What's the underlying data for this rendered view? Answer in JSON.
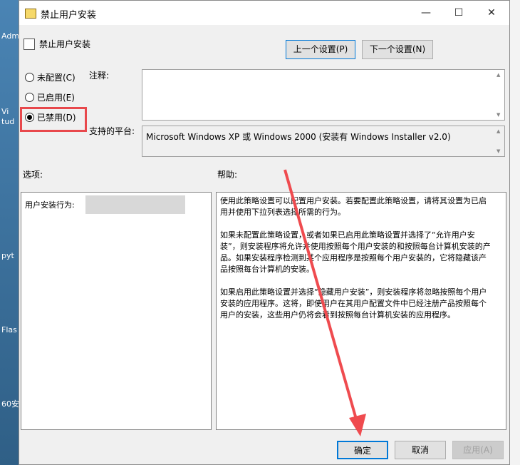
{
  "window": {
    "title": "禁止用户安装",
    "policy_name": "禁止用户安装"
  },
  "titlebar": {
    "minimize_glyph": "—",
    "maximize_glyph": "☐",
    "close_glyph": "✕"
  },
  "nav": {
    "prev_label": "上一个设置(P)",
    "next_label": "下一个设置(N)"
  },
  "state_options": [
    {
      "label": "未配置(C)",
      "selected": false
    },
    {
      "label": "已启用(E)",
      "selected": false
    },
    {
      "label": "已禁用(D)",
      "selected": true
    }
  ],
  "comment": {
    "label": "注释:",
    "value": ""
  },
  "platform": {
    "label": "支持的平台:",
    "value": "Microsoft Windows XP 或 Windows 2000 (安装有 Windows Installer v2.0)"
  },
  "options": {
    "heading": "选项:",
    "behavior_label": "用户安装行为:"
  },
  "help": {
    "heading": "帮助:",
    "paragraphs": [
      "使用此策略设置可以配置用户安装。若要配置此策略设置，请将其设置为已启用并使用下拉列表选择所需的行为。",
      "如果未配置此策略设置，或者如果已启用此策略设置并选择了“允许用户安装”，则安装程序将允许并使用按照每个用户安装的和按照每台计算机安装的产品。如果安装程序检测到某个应用程序是按照每个用户安装的，它将隐藏该产品按照每台计算机的安装。",
      "如果启用此策略设置并选择“隐藏用户安装”，则安装程序将忽略按照每个用户安装的应用程序。这将，即使用户在其用户配置文件中已经注册产品按照每个用户的安装，这些用户仍将会看到按照每台计算机安装的应用程序。"
    ]
  },
  "footer": {
    "ok_label": "确定",
    "cancel_label": "取消",
    "apply_label": "应用(A)"
  },
  "desktop": {
    "labels": [
      "Adm",
      "Vi",
      "tud",
      "pyt",
      "Flas",
      "60安"
    ]
  }
}
